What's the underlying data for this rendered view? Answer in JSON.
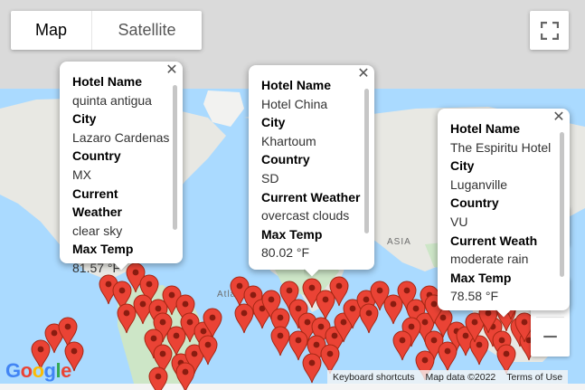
{
  "map_type": {
    "map_label": "Map",
    "satellite_label": "Satellite",
    "selected": "Map"
  },
  "map_labels": {
    "asia": "ASIA",
    "atlantic": "Atlant"
  },
  "info_windows": [
    {
      "hotel_label": "Hotel Name",
      "hotel": "quinta antigua",
      "city_label": "City",
      "city": "Lazaro Cardenas",
      "country_label": "Country",
      "country": "MX",
      "weather_label": "Current Weather",
      "weather": "clear sky",
      "temp_label": "Max Temp",
      "temp": "81.57 °F"
    },
    {
      "hotel_label": "Hotel Name",
      "hotel": "Hotel China",
      "city_label": "City",
      "city": "Khartoum",
      "country_label": "Country",
      "country": "SD",
      "weather_label": "Current Weather",
      "weather": "overcast clouds",
      "temp_label": "Max Temp",
      "temp": "80.02 °F"
    },
    {
      "hotel_label": "Hotel Name",
      "hotel": "The Espiritu Hotel",
      "city_label": "City",
      "city": "Luganville",
      "country_label": "Country",
      "country": "VU",
      "weather_label": "Current Weath",
      "weather": "moderate rain",
      "temp_label": "Max Temp",
      "temp": "78.58 °F"
    }
  ],
  "zoom": {
    "in_label": "+",
    "out_label": "−"
  },
  "footer": {
    "shortcuts": "Keyboard shortcuts",
    "map_data": "Map data ©2022",
    "terms": "Terms of Use"
  },
  "logo_text": "Google",
  "colors": {
    "water": "#aadaff",
    "land": "#e8e8e3",
    "green_land": "#cde6c7",
    "marker": "#ea4335",
    "marker_dark": "#a52714"
  }
}
